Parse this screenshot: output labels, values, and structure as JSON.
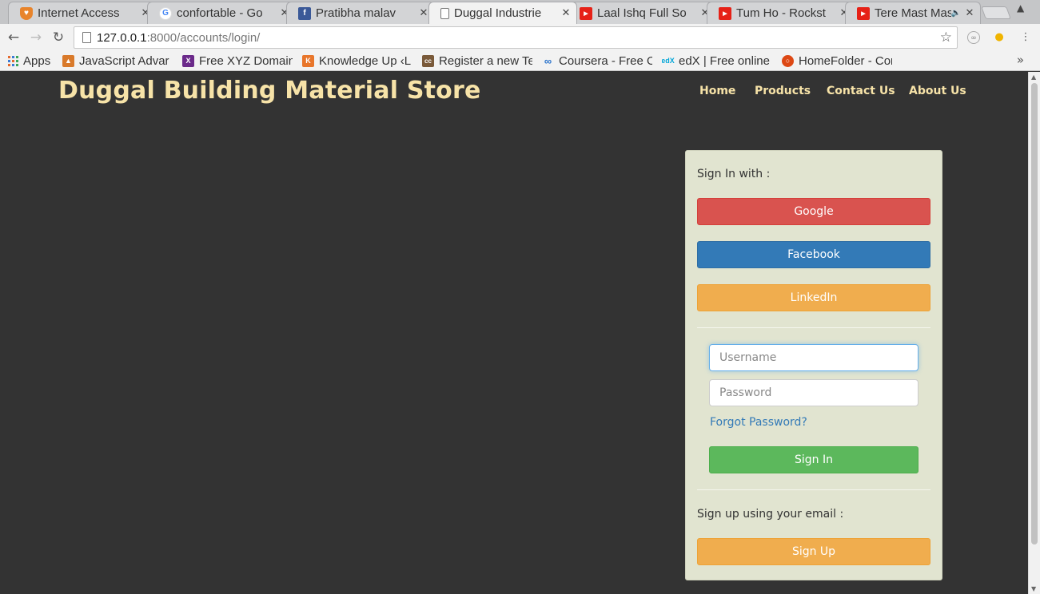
{
  "tabs": [
    {
      "label": "Internet Access",
      "icon": "shield-icon",
      "color": "#e8842b"
    },
    {
      "label": "confortable - Go",
      "icon": "google-icon",
      "color": "#4285f4"
    },
    {
      "label": "Pratibha malav",
      "icon": "facebook-icon",
      "color": "#3b5998"
    },
    {
      "label": "Duggal Industrie",
      "icon": "page-icon",
      "color": "#ffffff"
    },
    {
      "label": "Laal Ishq Full So",
      "icon": "youtube-icon",
      "color": "#e62117"
    },
    {
      "label": "Tum Ho - Rockst",
      "icon": "youtube-icon",
      "color": "#e62117"
    },
    {
      "label": "Tere Mast Mas",
      "icon": "youtube-icon",
      "color": "#e62117"
    }
  ],
  "address": {
    "host": "127.0.0.1",
    "rest": ":8000/accounts/login/"
  },
  "bookmarks": [
    {
      "label": "Apps",
      "icon": "apps-icon"
    },
    {
      "label": "JavaScript Advar",
      "icon": "fox-icon",
      "color": "#d97a2b"
    },
    {
      "label": "Free XYZ Domain",
      "icon": "xyz-icon",
      "color": "#6b2a8a"
    },
    {
      "label": "Knowledge Up ‹L",
      "icon": "knowledge-icon",
      "color": "#e8762b"
    },
    {
      "label": "Register a new Te",
      "icon": "cc-icon",
      "color": "#7a5a3a"
    },
    {
      "label": "Coursera - Free O",
      "icon": "coursera-icon",
      "color": "#2a73cc"
    },
    {
      "label": "edX | Free online",
      "icon": "edx-icon",
      "color": "#02a6d8"
    },
    {
      "label": "HomeFolder - Cor",
      "icon": "ubuntu-icon",
      "color": "#dd4814"
    }
  ],
  "site": {
    "brand": "Duggal Building Material Store",
    "nav": [
      "Home",
      "Products",
      "Contact Us",
      "About Us"
    ]
  },
  "login": {
    "sign_in_with": "Sign In with :",
    "google": "Google",
    "facebook": "Facebook",
    "linkedin": "LinkedIn",
    "username_placeholder": "Username",
    "password_placeholder": "Password",
    "forgot": "Forgot Password?",
    "sign_in": "Sign In",
    "sign_up_prompt": "Sign up using your email :",
    "sign_up": "Sign Up"
  }
}
